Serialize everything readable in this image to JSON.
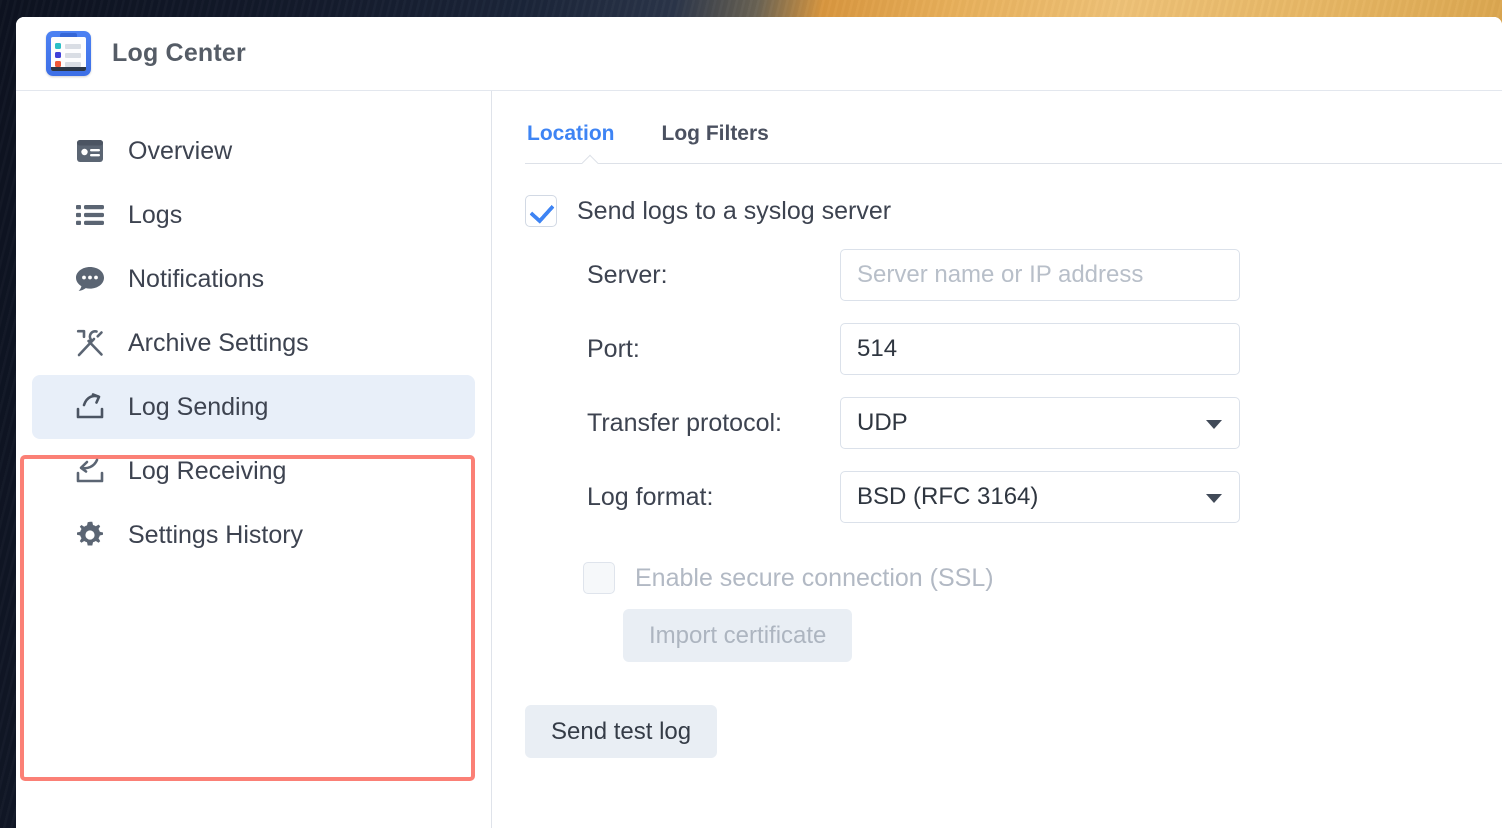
{
  "window": {
    "app_title": "Log Center",
    "app_icon": "clipboard-list-icon"
  },
  "sidebar": {
    "items": [
      {
        "label": "Overview",
        "icon": "overview-card-icon",
        "active": false
      },
      {
        "label": "Logs",
        "icon": "list-icon",
        "active": false
      },
      {
        "label": "Notifications",
        "icon": "chat-bubble-icon",
        "active": false
      },
      {
        "label": "Archive Settings",
        "icon": "tools-icon",
        "active": false
      },
      {
        "label": "Log Sending",
        "icon": "upload-share-icon",
        "active": true
      },
      {
        "label": "Log Receiving",
        "icon": "download-tray-icon",
        "active": false
      },
      {
        "label": "Settings History",
        "icon": "gear-icon",
        "active": false
      }
    ],
    "annotation": {
      "present": true,
      "color": "#fb8076",
      "covers": [
        "Archive Settings",
        "Log Sending",
        "Log Receiving",
        "Settings History"
      ]
    }
  },
  "content": {
    "tabs": [
      {
        "label": "Location",
        "active": true
      },
      {
        "label": "Log Filters",
        "active": false
      }
    ],
    "syslog": {
      "enable_label": "Send logs to a syslog server",
      "enabled": true,
      "fields": [
        {
          "label": "Server:",
          "type": "text",
          "value": "",
          "placeholder": "Server name or IP address"
        },
        {
          "label": "Port:",
          "type": "text",
          "value": "514",
          "placeholder": ""
        },
        {
          "label": "Transfer protocol:",
          "type": "select",
          "value": "UDP",
          "placeholder": ""
        },
        {
          "label": "Log format:",
          "type": "select",
          "value": "BSD (RFC 3164)",
          "placeholder": ""
        }
      ],
      "ssl": {
        "label": "Enable secure connection (SSL)",
        "checked": false,
        "disabled": true
      },
      "import_certificate_label": "Import certificate",
      "import_certificate_disabled": true,
      "send_test_log_label": "Send test log"
    }
  },
  "colors": {
    "accent": "#3e84f4",
    "annotation": "#fb8076",
    "active_nav_bg": "#e8eff9",
    "button_bg": "#e9eef4",
    "text": "#3d4350",
    "muted_text": "#b2b9c4"
  }
}
